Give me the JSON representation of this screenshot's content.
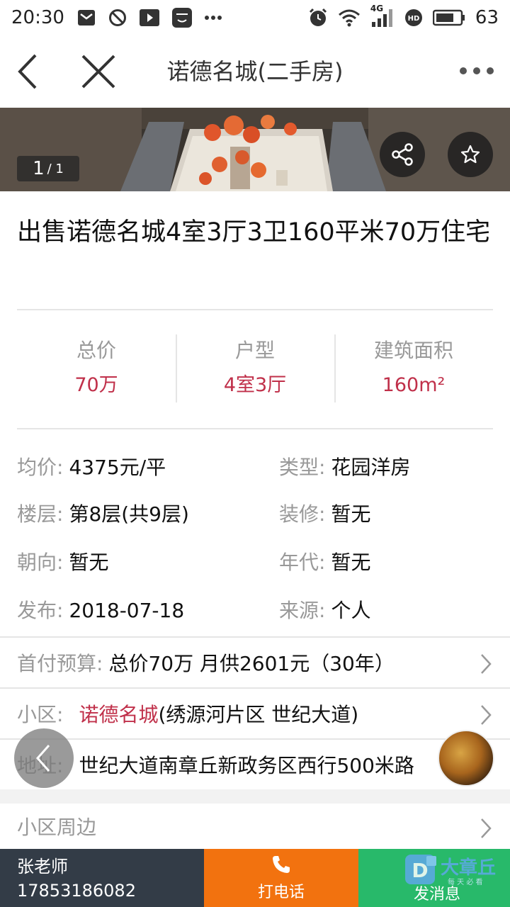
{
  "status_bar": {
    "time": "20:30",
    "signal_label": "4G",
    "battery": "63",
    "left_icons": [
      "mail-icon",
      "block-icon",
      "play-icon",
      "life-app-icon",
      "more-dots-icon"
    ],
    "right_icons": [
      "alarm-icon",
      "wifi-icon",
      "cell-signal-icon",
      "hd-icon",
      "battery-icon"
    ]
  },
  "nav": {
    "title": "诺德名城(二手房)"
  },
  "hero": {
    "counter_current": "1",
    "counter_total": "/ 1"
  },
  "listing": {
    "title": "出售诺德名城4室3厅3卫160平米70万住宅"
  },
  "stats": [
    {
      "label": "总价",
      "value": "70万"
    },
    {
      "label": "户型",
      "value": "4室3厅"
    },
    {
      "label": "建筑面积",
      "value": "160m²"
    }
  ],
  "details": {
    "avg_price": {
      "key": "均价:",
      "value": "4375元/平"
    },
    "type": {
      "key": "类型:",
      "value": "花园洋房"
    },
    "floor": {
      "key": "楼层:",
      "value": "第8层(共9层)"
    },
    "decoration": {
      "key": "装修:",
      "value": "暂无"
    },
    "orientation": {
      "key": "朝向:",
      "value": "暂无"
    },
    "year": {
      "key": "年代:",
      "value": "暂无"
    },
    "published": {
      "key": "发布:",
      "value": "2018-07-18"
    },
    "source": {
      "key": "来源:",
      "value": "个人"
    }
  },
  "rows": {
    "down_payment": {
      "key": "首付预算:",
      "value": "总价70万 月供2601元（30年）"
    },
    "community": {
      "key": "小区:",
      "name": "诺德名城",
      "rest": "(绣源河片区 世纪大道)"
    },
    "address": {
      "key": "地址:",
      "value": "世纪大道南章丘新政务区西行500米路"
    },
    "nearby": {
      "key": "小区周边"
    }
  },
  "bottom": {
    "agent_name": "张老师",
    "agent_phone": "17853186082",
    "call_label": "打电话",
    "message_label": "发消息",
    "watermark_text": "大章丘",
    "watermark_sub": "每 天 必 看"
  },
  "colors": {
    "accent_red": "#c0304a",
    "call_orange": "#f2720f",
    "message_green": "#28b96a",
    "contact_dark": "#333c47"
  }
}
